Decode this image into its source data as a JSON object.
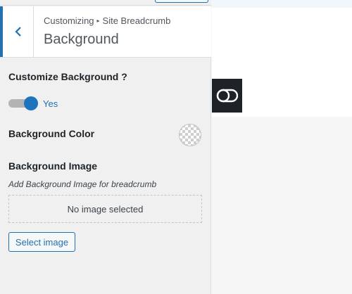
{
  "header": {
    "breadcrumb_parent": "Customizing",
    "breadcrumb_separator": "▸",
    "breadcrumb_section": "Site Breadcrumb",
    "title": "Background",
    "back_icon": "chevron-left-icon"
  },
  "controls": {
    "customize_background": {
      "label": "Customize Background ?",
      "toggle_on": true,
      "toggle_text": "Yes"
    },
    "background_color": {
      "label": "Background Color",
      "value": "transparent"
    },
    "background_image": {
      "label": "Background Image",
      "description": "Add Background Image for breadcrumb",
      "placeholder": "No image selected",
      "button_label": "Select image"
    }
  },
  "preview": {
    "toggle_icon": "toggle-icon"
  },
  "colors": {
    "accent": "#2271b1",
    "toggle_on": "#1e73be",
    "panel_bg": "#f0f0f1"
  }
}
